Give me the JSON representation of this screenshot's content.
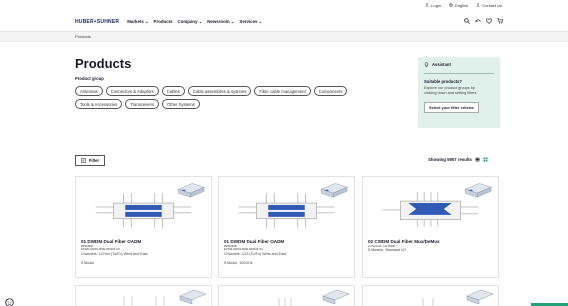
{
  "topbar": {
    "login": "Login",
    "language": "English",
    "contact": "Contact Us"
  },
  "nav": {
    "logo": "HUBER+SUHNER",
    "items": [
      "Markets",
      "Products",
      "Company",
      "Newsroom",
      "Services"
    ]
  },
  "breadcrumb": "Products",
  "page": {
    "title": "Products",
    "group_label": "Product group",
    "chips": [
      "Antennas",
      "Connectors & Adaptors",
      "Cables",
      "Cable assemblies & systems",
      "Fiber cable management",
      "Components",
      "Tools & Accessories",
      "Transceivers",
      "Other Systems"
    ]
  },
  "assistant": {
    "heading": "Assistant",
    "question": "Suitable products?",
    "text_line1": "Explore our product groups by",
    "text_line2": "clicking down and setting filters",
    "button": "Select your filter criteria"
  },
  "toolbar": {
    "filter": "Filter",
    "results": "Showing 5907 results"
  },
  "cards": [
    {
      "title": "01 DWDM Dual Fiber OADM",
      "sku1": "85023937",
      "sku2": "ET000-00019-0000-000016-XX",
      "desc": "Channels: 147nm (To/Fo) West and East",
      "meta": "5 Modul"
    },
    {
      "title": "01 DWDM Dual Fiber OADM",
      "sku1": "85023938",
      "sku2": "ET000-00019-0000-000016-XX",
      "desc": "Channels: C23 (To/Fo) West and East",
      "meta": "5 Modul, 100GHz"
    },
    {
      "title": "02 CWDM Dual Fiber Mux/DeMux",
      "sku1": "2 channels, 1x3 80dB",
      "sku2": "ET000-00019-0000-000016-XX",
      "desc": "5 Module, Standard I/O",
      "meta": ""
    }
  ],
  "colors": {
    "brand": "#1b2a6b",
    "assistant_bg": "#e0f0eb",
    "grid_active": "#1fa37a",
    "diagram_blue": "#2f5bb7"
  }
}
